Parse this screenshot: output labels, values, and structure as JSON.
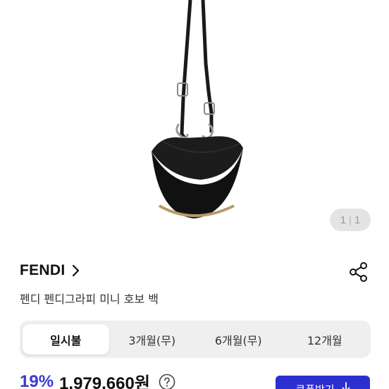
{
  "product": {
    "image_alt": "product photo",
    "image_counter": {
      "current": "1",
      "separator": "|",
      "total": "1"
    }
  },
  "brand": {
    "name": "FENDI"
  },
  "title": "펜디 펜디그라피 미니 호보 백",
  "installment_tabs": [
    {
      "label": "일시불",
      "active": true
    },
    {
      "label": "3개월(무)",
      "active": false
    },
    {
      "label": "6개월(무)",
      "active": false
    },
    {
      "label": "12개월",
      "active": false
    }
  ],
  "price": {
    "discount": "19%",
    "amount": "1,979,660원"
  },
  "coupon_button": {
    "label": "쿠폰받기",
    "icon": "download-arrow-icon"
  },
  "colors": {
    "accent": "#2b2fd0",
    "discount": "#3a3ad6",
    "tab_bg": "#efefef"
  }
}
